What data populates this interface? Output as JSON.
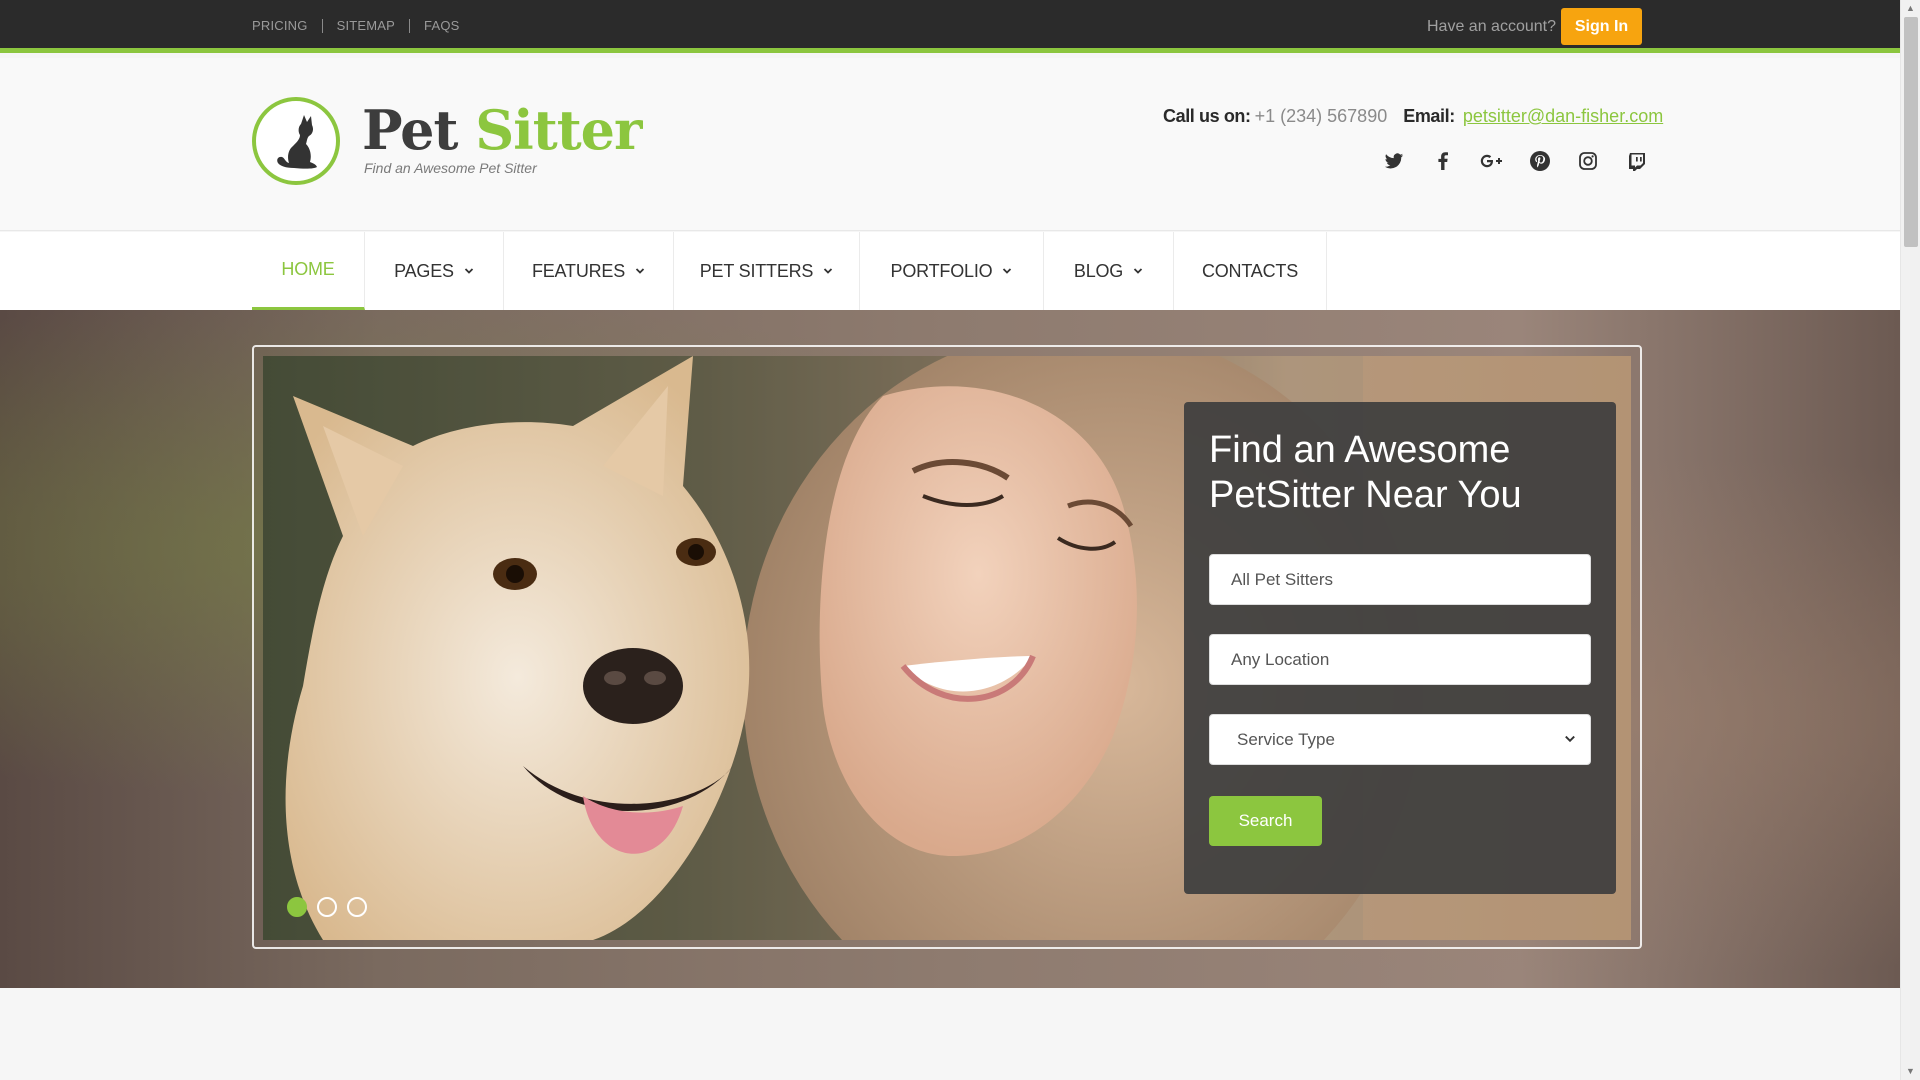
{
  "topbar": {
    "links": [
      "PRICING",
      "SITEMAP",
      "FAQS"
    ],
    "account_text": "Have an account?",
    "signin_label": "Sign In"
  },
  "header": {
    "logo_word1": "Pet",
    "logo_word2": "Sitter",
    "tagline": "Find an Awesome Pet Sitter",
    "call_label": "Call us on:",
    "phone": "+1 (234) 567890",
    "email_label": "Email:",
    "email": "petsitter@dan-fisher.com",
    "socials": [
      "twitter-icon",
      "facebook-icon",
      "google-plus-icon",
      "pinterest-icon",
      "instagram-icon",
      "twitch-icon"
    ]
  },
  "nav": {
    "items": [
      {
        "label": "HOME",
        "active": true,
        "dropdown": false
      },
      {
        "label": "PAGES",
        "active": false,
        "dropdown": true
      },
      {
        "label": "FEATURES",
        "active": false,
        "dropdown": true
      },
      {
        "label": "PET SITTERS",
        "active": false,
        "dropdown": true
      },
      {
        "label": "PORTFOLIO",
        "active": false,
        "dropdown": true
      },
      {
        "label": "BLOG",
        "active": false,
        "dropdown": true
      },
      {
        "label": "CONTACTS",
        "active": false,
        "dropdown": false
      }
    ]
  },
  "hero": {
    "search_title": "Find an Awesome PetSitter Near You",
    "sitters_placeholder": "All Pet Sitters",
    "location_placeholder": "Any Location",
    "service_type_selected": "Service Type",
    "search_label": "Search",
    "slides_count": 3,
    "active_slide": 1
  },
  "colors": {
    "accent": "#8cc63f",
    "signin": "#f7a40f",
    "topbar": "#2b2b2b"
  }
}
